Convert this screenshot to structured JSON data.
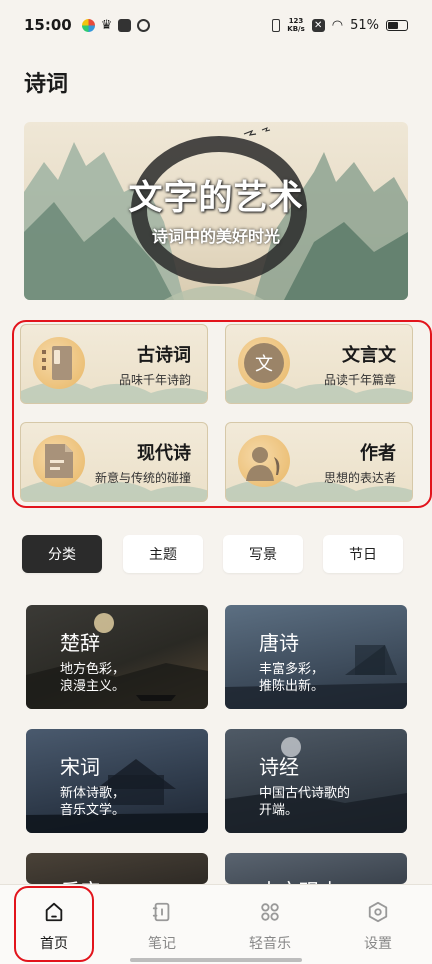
{
  "status_bar": {
    "time": "15:00",
    "network_speed_value": "123",
    "network_speed_unit": "KB/s",
    "battery_percent": "51%",
    "battery_level": 0.51
  },
  "page": {
    "title": "诗词"
  },
  "banner": {
    "title": "文字的艺术",
    "subtitle": "诗词中的美好时光"
  },
  "features": [
    {
      "title": "古诗词",
      "desc": "品味千年诗韵",
      "icon": "book-icon"
    },
    {
      "title": "文言文",
      "desc": "品读千年篇章",
      "icon": "wen-character-icon",
      "glyph": "文"
    },
    {
      "title": "现代诗",
      "desc": "新意与传统的碰撞",
      "icon": "document-icon"
    },
    {
      "title": "作者",
      "desc": "思想的表达者",
      "icon": "author-quill-icon"
    }
  ],
  "tabs": [
    {
      "label": "分类",
      "active": true
    },
    {
      "label": "主题",
      "active": false
    },
    {
      "label": "写景",
      "active": false
    },
    {
      "label": "节日",
      "active": false
    }
  ],
  "categories": [
    {
      "title": "楚辞",
      "desc_line1": "地方色彩，",
      "desc_line2": "浪漫主义。"
    },
    {
      "title": "唐诗",
      "desc_line1": "丰富多彩，",
      "desc_line2": "推陈出新。"
    },
    {
      "title": "宋词",
      "desc_line1": "新体诗歌，",
      "desc_line2": "音乐文学。"
    },
    {
      "title": "诗经",
      "desc_line1": "中国古代诗歌的",
      "desc_line2": "开端。"
    },
    {
      "title": "乐府",
      "desc_line1": "",
      "desc_line2": ""
    },
    {
      "title": "古文观止",
      "desc_line1": "",
      "desc_line2": ""
    }
  ],
  "bottom_nav": [
    {
      "label": "首页",
      "icon": "home-icon",
      "active": true
    },
    {
      "label": "笔记",
      "icon": "notebook-icon",
      "active": false
    },
    {
      "label": "轻音乐",
      "icon": "music-grid-icon",
      "active": false
    },
    {
      "label": "设置",
      "icon": "settings-hexagon-icon",
      "active": false
    }
  ],
  "colors": {
    "background": "#f6f3ee",
    "accent_outline": "#e2141c",
    "active_tab": "#2b2b2b"
  }
}
